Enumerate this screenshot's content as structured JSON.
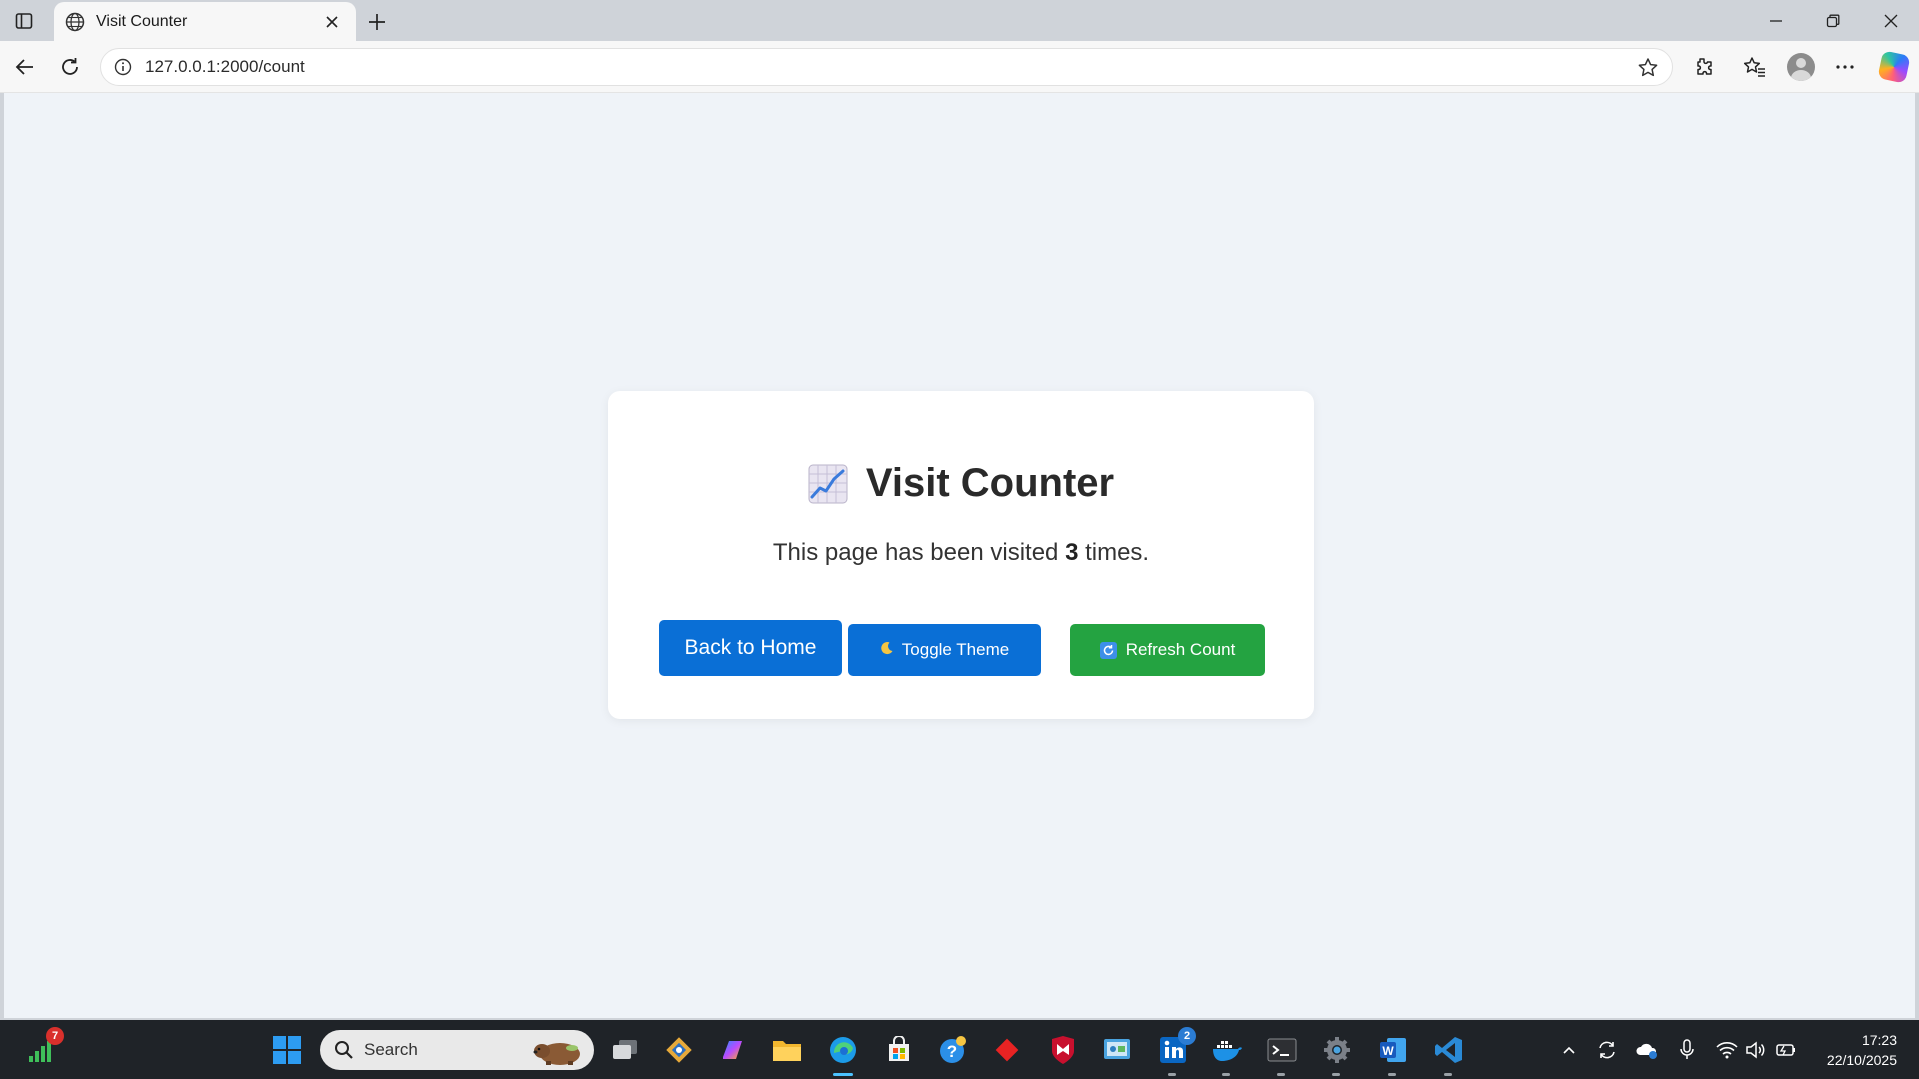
{
  "browser": {
    "tab_title": "Visit Counter",
    "url": "127.0.0.1:2000/count"
  },
  "page": {
    "heading": "Visit Counter",
    "visits_prefix": "This page has been visited",
    "visit_count": "3",
    "visits_suffix": "times.",
    "buttons": {
      "home": "Back to Home",
      "theme": "Toggle Theme",
      "refresh": "Refresh Count"
    },
    "colors": {
      "primary": "#0a6fd6",
      "success": "#24a341",
      "background": "#eff3f8"
    }
  },
  "taskbar": {
    "search_placeholder": "Search",
    "signal_badge": "7",
    "linkedin_badge": "2",
    "time": "17:23",
    "date": "22/10/2025"
  }
}
